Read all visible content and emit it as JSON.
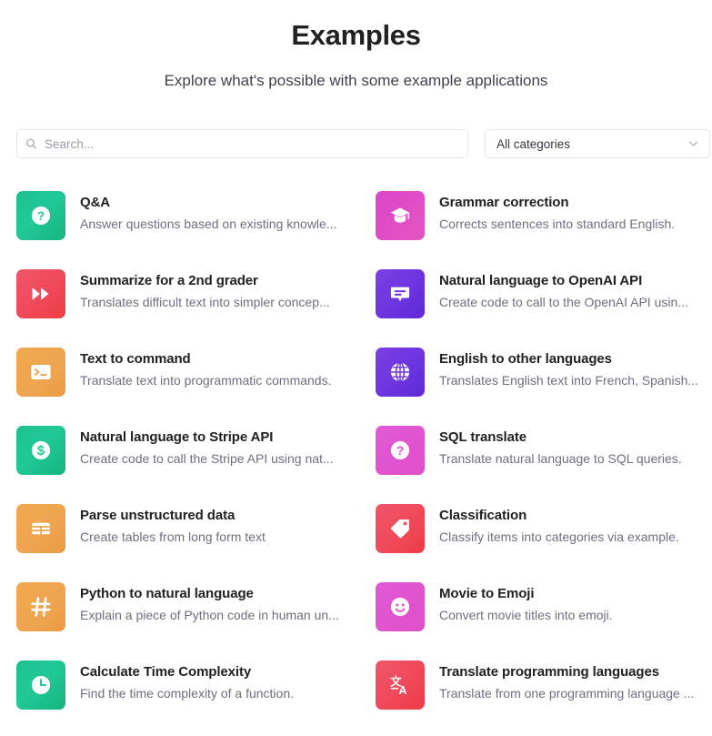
{
  "header": {
    "title": "Examples",
    "subtitle": "Explore what's possible with some example applications"
  },
  "search": {
    "placeholder": "Search...",
    "value": "",
    "icon": "search-icon"
  },
  "category_filter": {
    "selected": "All categories",
    "icon": "chevron-down-icon"
  },
  "examples": [
    {
      "title": "Q&A",
      "description": "Answer questions based on existing knowle...",
      "icon": "question-circle-icon",
      "color": "#20c997",
      "palette": "grad-green"
    },
    {
      "title": "Grammar correction",
      "description": "Corrects sentences into standard English.",
      "icon": "graduation-cap-icon",
      "color": "#e04cc6",
      "palette": "grad-pink"
    },
    {
      "title": "Summarize for a 2nd grader",
      "description": "Translates difficult text into simpler concep...",
      "icon": "fast-forward-icon",
      "color": "#f04a5c",
      "palette": "grad-red"
    },
    {
      "title": "Natural language to OpenAI API",
      "description": "Create code to call to the OpenAI API usin...",
      "icon": "chat-bubble-icon",
      "color": "#6d35df",
      "palette": "grad-purple"
    },
    {
      "title": "Text to command",
      "description": "Translate text into programmatic commands.",
      "icon": "terminal-icon",
      "color": "#efa550",
      "palette": "grad-orange"
    },
    {
      "title": "English to other languages",
      "description": "Translates English text into French, Spanish...",
      "icon": "globe-icon",
      "color": "#6d35df",
      "palette": "grad-purple"
    },
    {
      "title": "Natural language to Stripe API",
      "description": "Create code to call the Stripe API using nat...",
      "icon": "dollar-circle-icon",
      "color": "#20c997",
      "palette": "grad-green"
    },
    {
      "title": "SQL translate",
      "description": "Translate natural language to SQL queries.",
      "icon": "question-circle-icon",
      "color": "#e04fc8",
      "palette": "grad-magenta"
    },
    {
      "title": "Parse unstructured data",
      "description": "Create tables from long form text",
      "icon": "table-icon",
      "color": "#efa550",
      "palette": "grad-orange"
    },
    {
      "title": "Classification",
      "description": "Classify items into categories via example.",
      "icon": "tag-icon",
      "color": "#f04a5c",
      "palette": "grad-red"
    },
    {
      "title": "Python to natural language",
      "description": "Explain a piece of Python code in human un...",
      "icon": "hash-icon",
      "color": "#efa550",
      "palette": "grad-orange"
    },
    {
      "title": "Movie to Emoji",
      "description": "Convert movie titles into emoji.",
      "icon": "smiley-face-icon",
      "color": "#e04fc8",
      "palette": "grad-magenta"
    },
    {
      "title": "Calculate Time Complexity",
      "description": "Find the time complexity of a function.",
      "icon": "clock-icon",
      "color": "#20c997",
      "palette": "grad-green"
    },
    {
      "title": "Translate programming languages",
      "description": "Translate from one programming language ...",
      "icon": "translate-icon",
      "color": "#f04a5c",
      "palette": "grad-red"
    }
  ]
}
